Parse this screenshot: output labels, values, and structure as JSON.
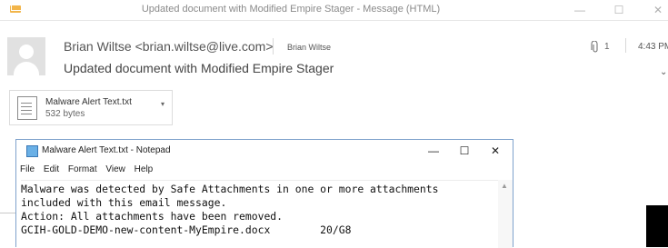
{
  "window": {
    "title": "Updated document with Modified Empire Stager - Message (HTML)",
    "minimize": "—",
    "maximize": "☐",
    "close": "✕"
  },
  "header": {
    "sender": "Brian Wiltse <brian.wiltse@live.com>",
    "to": "Brian Wiltse",
    "subject": "Updated document with Modified Empire Stager",
    "attachment_count": "1",
    "time": "4:43 PM",
    "expand": "⌄"
  },
  "attachment": {
    "name": "Malware Alert Text.txt",
    "size": "532 bytes"
  },
  "notepad": {
    "title": "Malware Alert Text.txt - Notepad",
    "minimize": "—",
    "maximize": "☐",
    "close": "✕",
    "menu": [
      "File",
      "Edit",
      "Format",
      "View",
      "Help"
    ],
    "text": "Malware was detected by Safe Attachments in one or more attachments\nincluded with this email message.\nAction: All attachments have been removed.\nGCIH-GOLD-DEMO-new-content-MyEmpire.docx        20/G8"
  },
  "icons": {
    "app": "envelope-icon",
    "avatar": "person-avatar-icon",
    "attachment": "paperclip-icon",
    "file": "text-file-icon",
    "notepad": "notepad-icon"
  }
}
